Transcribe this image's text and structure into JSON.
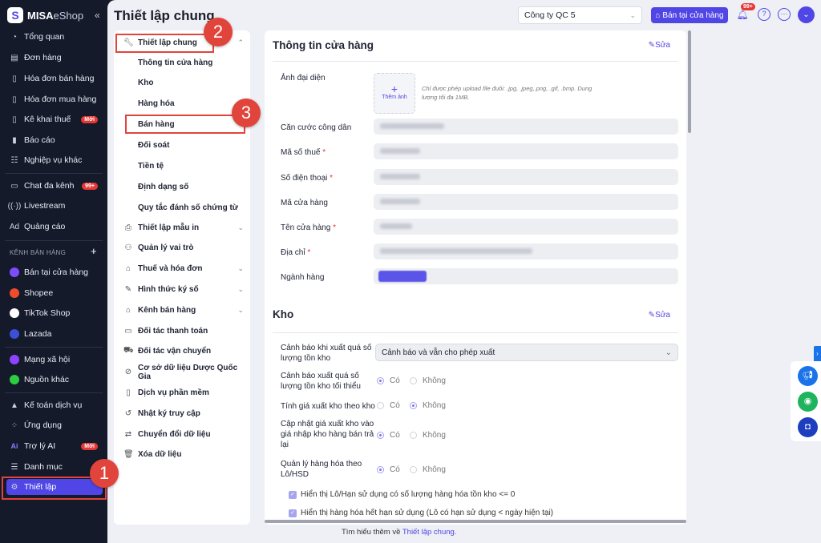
{
  "brand": {
    "name_bold": "MISA",
    "name_light": "eShop"
  },
  "sidebar": {
    "items": [
      {
        "label": "Tổng quan",
        "icon": "◔"
      },
      {
        "label": "Đơn hàng",
        "icon": "▤"
      },
      {
        "label": "Hóa đơn bán hàng",
        "icon": "▯"
      },
      {
        "label": "Hóa đơn mua hàng",
        "icon": "▯"
      },
      {
        "label": "Kê khai thuế",
        "icon": "▯",
        "badge": "Mới"
      },
      {
        "label": "Báo cáo",
        "icon": "▮"
      },
      {
        "label": "Nghiệp vụ khác",
        "icon": "☷"
      },
      {
        "label": "Chat đa kênh",
        "icon": "▭",
        "badge": "99+"
      },
      {
        "label": "Livestream",
        "icon": "((·))"
      },
      {
        "label": "Quảng cáo",
        "icon": "Ad"
      }
    ],
    "section_label": "KÊNH BÁN HÀNG",
    "channels": [
      {
        "label": "Bán tại cửa hàng",
        "color": "#7c4dff"
      },
      {
        "label": "Shopee",
        "color": "#ee4d2d"
      },
      {
        "label": "TikTok Shop",
        "color": "#ffffff"
      },
      {
        "label": "Lazada",
        "color": "#3b4fd8"
      },
      {
        "label": "Mạng xã hội",
        "color": "#8e44ff"
      },
      {
        "label": "Nguồn khác",
        "color": "#2ecc40"
      }
    ],
    "bottom": [
      {
        "label": "Kế toán dịch vụ",
        "icon": "▲"
      },
      {
        "label": "Ứng dụng",
        "icon": "⁘"
      },
      {
        "label": "Trợ lý AI",
        "icon": "Ai",
        "badge": "Mới"
      },
      {
        "label": "Danh mục",
        "icon": "☰"
      },
      {
        "label": "Thiết lập",
        "icon": "⚙"
      }
    ]
  },
  "header": {
    "title": "Thiết lập chung",
    "company": "Công ty QC 5",
    "store_button": "Bán tại cửa hàng",
    "notif_badge": "99+"
  },
  "steps": [
    "1",
    "2",
    "3"
  ],
  "settings_nav": {
    "group": "Thiết lập chung",
    "subitems": [
      "Thông tin cửa hàng",
      "Kho",
      "Hàng hóa",
      "Bán hàng",
      "Đối soát",
      "Tiền tệ",
      "Định dạng số",
      "Quy tắc đánh số chứng từ"
    ],
    "items": [
      {
        "label": "Thiết lập mẫu in",
        "icon": "⎙",
        "chev": true
      },
      {
        "label": "Quản lý vai trò",
        "icon": "⚇"
      },
      {
        "label": "Thuế và hóa đơn",
        "icon": "⌂",
        "chev": true
      },
      {
        "label": "Hình thức ký số",
        "icon": "✎",
        "chev": true
      },
      {
        "label": "Kênh bán hàng",
        "icon": "⌂",
        "chev": true
      },
      {
        "label": "Đối tác thanh toán",
        "icon": "▭"
      },
      {
        "label": "Đối tác vận chuyển",
        "icon": "⛟"
      },
      {
        "label": "Cơ sở dữ liệu Dược Quốc Gia",
        "icon": "⊘"
      },
      {
        "label": "Dịch vụ phần mềm",
        "icon": "▯"
      },
      {
        "label": "Nhật ký truy cập",
        "icon": "↺"
      },
      {
        "label": "Chuyển đổi dữ liệu",
        "icon": "⇄"
      },
      {
        "label": "Xóa dữ liệu",
        "icon": "🗑"
      }
    ]
  },
  "store_info": {
    "title": "Thông tin cửa hàng",
    "edit": "Sửa",
    "avatar_label": "Ảnh đại diện",
    "upload_label": "Thêm ảnh",
    "upload_hint": "Chỉ được phép upload file đuôi: .jpg, .jpeg,.png, .gif, .bmp. Dung lượng tối đa 1MB.",
    "fields": [
      {
        "label": "Căn cước công dân",
        "required": false
      },
      {
        "label": "Mã số thuế",
        "required": true
      },
      {
        "label": "Số điện thoại",
        "required": true
      },
      {
        "label": "Mã cửa hàng",
        "required": false
      },
      {
        "label": "Tên cửa hàng",
        "required": true
      },
      {
        "label": "Địa chỉ",
        "required": true
      },
      {
        "label": "Ngành hàng",
        "required": false
      }
    ]
  },
  "warehouse": {
    "title": "Kho",
    "edit": "Sửa",
    "select_label": "Cảnh báo khi xuất quá số lượng tồn kho",
    "select_value": "Cảnh báo và vẫn cho phép xuất",
    "yes": "Có",
    "no": "Không",
    "radios": [
      {
        "label": "Cảnh báo xuất quá số lượng tồn kho tối thiểu",
        "value": "yes"
      },
      {
        "label": "Tính giá xuất kho theo kho",
        "value": "no"
      },
      {
        "label": "Cập nhật giá xuất kho vào giá nhập kho hàng bán trả lại",
        "value": "yes"
      },
      {
        "label": "Quản lý hàng hóa theo Lô/HSD",
        "value": "yes"
      }
    ],
    "checks": [
      "Hiển thị Lô/Hạn sử dụng có số lượng hàng hóa tồn kho <= 0",
      "Hiển thị hàng hóa hết hạn sử dụng (Lô có hạn sử dụng < ngày hiện tại)"
    ]
  },
  "footer": {
    "text": "Tìm hiểu thêm về ",
    "link": "Thiết lập chung."
  },
  "colors": {
    "accent": "#4f46e5",
    "sidebar": "#151a2b",
    "highlight": "#e0443b"
  }
}
